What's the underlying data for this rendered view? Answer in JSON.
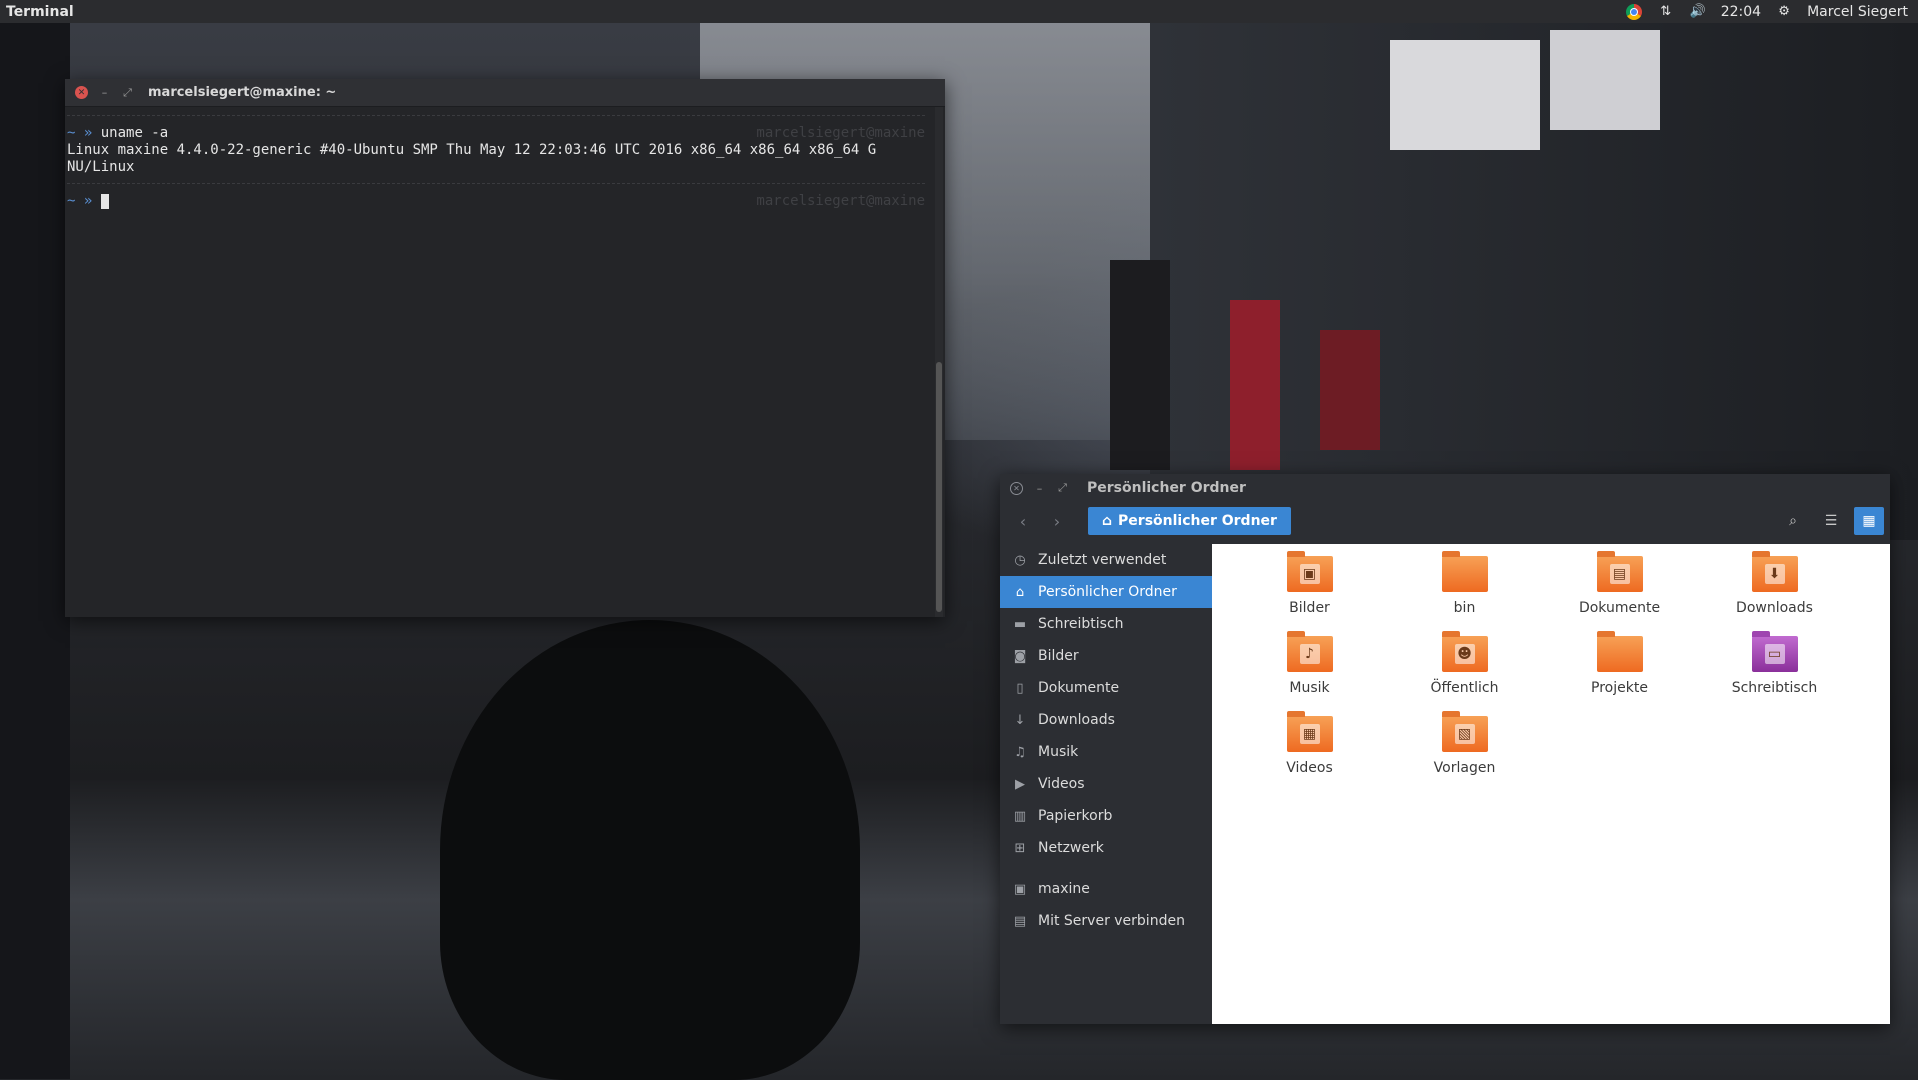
{
  "panel": {
    "app_name": "Terminal",
    "time": "22:04",
    "user": "Marcel Siegert"
  },
  "terminal": {
    "title": "marcelsiegert@maxine: ~",
    "lines": [
      {
        "prompt": "~ »",
        "text": " uname -a"
      },
      {
        "prompt": "",
        "text": "Linux maxine 4.4.0-22-generic #40-Ubuntu SMP Thu May 12 22:03:46 UTC 2016 x86_64 x86_64 x86_64 G"
      },
      {
        "prompt": "",
        "text": "NU/Linux"
      },
      {
        "prompt": "~ »",
        "text": " "
      }
    ],
    "right_prompt": "marcelsiegert@maxine"
  },
  "files": {
    "title": "Persönlicher Ordner",
    "path_label": "Persönlicher Ordner",
    "sidebar": [
      {
        "label": "Zuletzt verwendet",
        "icon": "clock-icon"
      },
      {
        "label": "Persönlicher Ordner",
        "icon": "home-icon",
        "active": true
      },
      {
        "label": "Schreibtisch",
        "icon": "folder-icon"
      },
      {
        "label": "Bilder",
        "icon": "camera-icon"
      },
      {
        "label": "Dokumente",
        "icon": "document-icon"
      },
      {
        "label": "Downloads",
        "icon": "download-icon"
      },
      {
        "label": "Musik",
        "icon": "music-icon"
      },
      {
        "label": "Videos",
        "icon": "video-icon"
      },
      {
        "label": "Papierkorb",
        "icon": "trash-icon"
      },
      {
        "label": "Netzwerk",
        "icon": "network-icon"
      },
      {
        "label": "maxine",
        "icon": "drive-icon"
      },
      {
        "label": "Mit Server verbinden",
        "icon": "server-icon"
      }
    ],
    "items": [
      {
        "label": "Bilder",
        "emblem": "picture-icon"
      },
      {
        "label": "bin",
        "emblem": ""
      },
      {
        "label": "Dokumente",
        "emblem": "document-icon"
      },
      {
        "label": "Downloads",
        "emblem": "download-icon"
      },
      {
        "label": "Musik",
        "emblem": "music-icon"
      },
      {
        "label": "Öffentlich",
        "emblem": "person-icon"
      },
      {
        "label": "Projekte",
        "emblem": ""
      },
      {
        "label": "Schreibtisch",
        "emblem": "desktop-icon"
      },
      {
        "label": "Videos",
        "emblem": "film-icon"
      },
      {
        "label": "Vorlagen",
        "emblem": "template-icon"
      }
    ]
  },
  "colors": {
    "accent": "#3a86d3",
    "folder_orange": "#ee6a21",
    "panel_bg": "#2b2c2f"
  }
}
